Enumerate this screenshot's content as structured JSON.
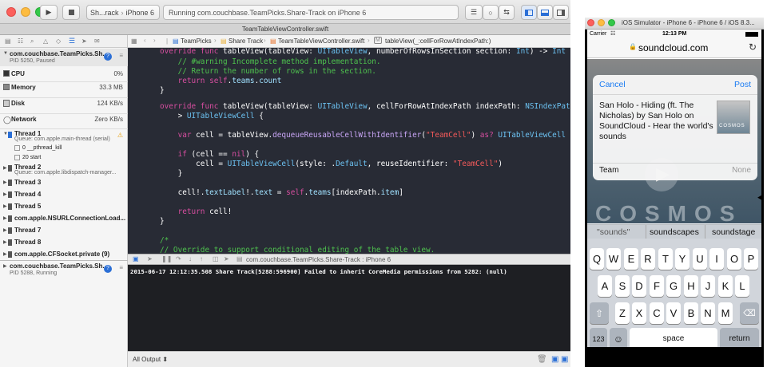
{
  "xcode": {
    "scheme": "Sh...rack",
    "device": "iPhone 6",
    "activity": "Running com.couchbase.TeamPicks.Share-Track on iPhone 6",
    "tab_title": "TeamTableViewController.swift",
    "jump_bar": [
      "TeamPicks",
      "Share Track",
      "TeamTableViewController.swift",
      "tableView(_:cellForRowAtIndexPath:)"
    ],
    "debug_bar_label": "com.couchbase.TeamPicks.Share-Track : iPhone 6",
    "console_output": "2015-06-17 12:12:35.508 Share Track[5288:596900] Failed to inherit CoreMedia permissions from 5282: (null)",
    "console_filter": "All Output ⬍"
  },
  "navigator": {
    "process1": {
      "name": "com.couchbase.TeamPicks.Sh...",
      "detail": "PID 5250, Paused"
    },
    "gauges": [
      {
        "name": "CPU",
        "value": "0%"
      },
      {
        "name": "Memory",
        "value": "33.3 MB"
      },
      {
        "name": "Disk",
        "value": "124 KB/s"
      },
      {
        "name": "Network",
        "value": "Zero KB/s"
      }
    ],
    "threads": [
      {
        "name": "Thread 1",
        "detail": "Queue: com.apple.main-thread (serial)"
      },
      {
        "name": "0 __pthread_kill"
      },
      {
        "name": "20 start"
      },
      {
        "name": "Thread 2",
        "detail": "Queue: com.apple.libdispatch-manager..."
      },
      {
        "name": "Thread 3"
      },
      {
        "name": "Thread 4"
      },
      {
        "name": "Thread 5"
      },
      {
        "name": "com.apple.NSURLConnectionLoad..."
      },
      {
        "name": "Thread 7"
      },
      {
        "name": "Thread 8"
      },
      {
        "name": "com.apple.CFSocket.private (9)"
      }
    ],
    "process2": {
      "name": "com.couchbase.TeamPicks.Sh...",
      "detail": "PID 5288, Running"
    }
  },
  "code": {
    "l1": [
      "override func ",
      "tableView",
      "(tableView: ",
      "UITableView",
      ", numberOfRowsInSection section: ",
      "Int",
      ") -> ",
      "Int",
      " {"
    ],
    "l2": "    // #warning Incomplete method implementation.",
    "l3": "    // Return the number of rows in the section.",
    "l4": [
      "    ",
      "return ",
      "self",
      ".",
      "teams",
      ".",
      "count"
    ],
    "l5": "}",
    "l6": [
      "override func ",
      "tableView",
      "(tableView: ",
      "UITableView",
      ", cellForRowAtIndexPath indexPath: ",
      "NSIndexPath",
      ") -"
    ],
    "l7": [
      "    > ",
      "UITableViewCell",
      " {"
    ],
    "l8": [
      "    ",
      "var ",
      "cell = tableView.",
      "dequeueReusableCellWithIdentifier",
      "(",
      "\"TeamCell\"",
      ") ",
      "as? ",
      "UITableViewCell"
    ],
    "l9": [
      "    ",
      "if ",
      "(cell == ",
      "nil",
      ") {"
    ],
    "l10": [
      "        cell = ",
      "UITableViewCell",
      "(style: .",
      "Default",
      ", reuseIdentifier: ",
      "\"TeamCell\"",
      ")"
    ],
    "l11": "    }",
    "l12": [
      "    cell!.",
      "textLabel",
      "!.",
      "text",
      " = ",
      "self",
      ".",
      "teams",
      "[indexPath.",
      "item",
      "]"
    ],
    "l13": [
      "    ",
      "return ",
      "cell!"
    ],
    "l14": "}",
    "l15": "/*",
    "l16": "// Override to support conditional editing of the table view."
  },
  "simulator": {
    "window_title": "iOS Simulator - iPhone 6 - iPhone 6 / iOS 8.3...",
    "carrier": "Carrier",
    "time": "12:13 PM",
    "url": "soundcloud.com",
    "share": {
      "cancel": "Cancel",
      "post": "Post",
      "text": "San Holo - Hiding (ft. The Nicholas) by San Holo on SoundCloud - Hear the world's sounds",
      "thumb_text": "COSMOS",
      "row_label": "Team",
      "row_value": "None"
    },
    "background_word": "COSMOS",
    "suggestions": [
      "\"sounds\"",
      "soundscapes",
      "soundstage"
    ],
    "keyboard": {
      "row1": [
        "Q",
        "W",
        "E",
        "R",
        "T",
        "Y",
        "U",
        "I",
        "O",
        "P"
      ],
      "row2": [
        "A",
        "S",
        "D",
        "F",
        "G",
        "H",
        "J",
        "K",
        "L"
      ],
      "row3": [
        "Z",
        "X",
        "C",
        "V",
        "B",
        "N",
        "M"
      ],
      "num": "123",
      "space": "space",
      "return": "return"
    }
  }
}
